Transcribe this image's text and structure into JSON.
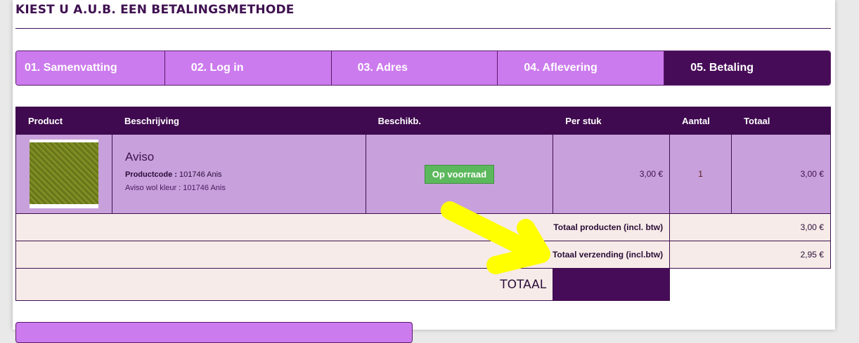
{
  "heading": "KIEST U A.U.B. EEN BETALINGSMETHODE",
  "steps": [
    {
      "label": "01. Samenvatting"
    },
    {
      "label": "02. Log in"
    },
    {
      "label": "03. Adres"
    },
    {
      "label": "04. Aflevering"
    },
    {
      "label": "05. Betaling"
    }
  ],
  "table": {
    "headers": {
      "product": "Product",
      "description": "Beschrijving",
      "availability": "Beschikb.",
      "unit_price": "Per stuk",
      "quantity": "Aantal",
      "total": "Totaal"
    },
    "item": {
      "name": "Aviso",
      "code_label": "Productcode :",
      "code_value": "101746 Anis",
      "attribute": "Aviso wol kleur : 101746 Anis",
      "availability": "Op voorraad",
      "unit_price": "3,00 €",
      "quantity": "1",
      "total": "3,00 €"
    },
    "summary": {
      "products_label": "Totaal producten (incl. btw)",
      "products_value": "3,00 €",
      "shipping_label": "Totaal verzending (incl.btw)",
      "shipping_value": "2,95 €",
      "grand_label": "TOTAAL",
      "grand_value": ""
    }
  },
  "colors": {
    "step_inactive": "#cc7bee",
    "step_active": "#470c58",
    "header_bg": "#3f0a4f",
    "row_bg": "#c8a0dc",
    "stock_badge": "#5cb85c",
    "annotation_arrow": "#ffff00"
  }
}
